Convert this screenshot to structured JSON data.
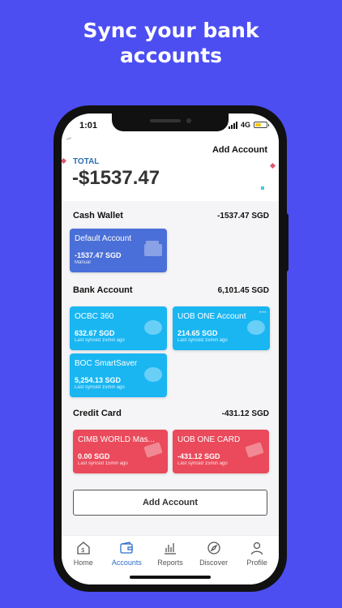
{
  "promo": {
    "line1": "Sync your bank",
    "line2": "accounts"
  },
  "status": {
    "time": "1:01",
    "network": "4G"
  },
  "header": {
    "add_account": "Add Account",
    "total_label": "TOTAL",
    "total_value": "-$1537.47"
  },
  "sections": {
    "cash": {
      "title": "Cash Wallet",
      "amount": "-1537.47 SGD",
      "cards": [
        {
          "name": "Default Account",
          "amount": "-1537.47 SGD",
          "sub": "Manual"
        }
      ]
    },
    "bank": {
      "title": "Bank Account",
      "amount": "6,101.45 SGD",
      "cards": [
        {
          "name": "OCBC 360",
          "amount": "632.67 SGD",
          "sub": "Last synced 15min ago"
        },
        {
          "name": "UOB ONE Account",
          "amount": "214.65 SGD",
          "sub": "Last synced 15min ago"
        },
        {
          "name": "BOC SmartSaver",
          "amount": "5,254.13 SGD",
          "sub": "Last synced 15min ago"
        }
      ]
    },
    "credit": {
      "title": "Credit Card",
      "amount": "-431.12 SGD",
      "cards": [
        {
          "name": "CIMB WORLD Mas...",
          "amount": "0.00 SGD",
          "sub": "Last synced 15min ago"
        },
        {
          "name": "UOB ONE CARD",
          "amount": "-431.12 SGD",
          "sub": "Last synced 15min ago"
        }
      ]
    }
  },
  "add_button": "Add Account",
  "tabs": [
    {
      "label": "Home",
      "icon": "home-icon"
    },
    {
      "label": "Accounts",
      "icon": "wallet-icon"
    },
    {
      "label": "Reports",
      "icon": "bar-chart-icon"
    },
    {
      "label": "Discover",
      "icon": "compass-icon"
    },
    {
      "label": "Profile",
      "icon": "user-icon"
    }
  ],
  "colors": {
    "background": "#4c4ef2",
    "bank_card": "#19b6f2",
    "cash_card": "#4a6fd8",
    "credit_card": "#ea4a5b",
    "active_tab": "#2f6fc9",
    "total_label": "#2e6fb0"
  }
}
